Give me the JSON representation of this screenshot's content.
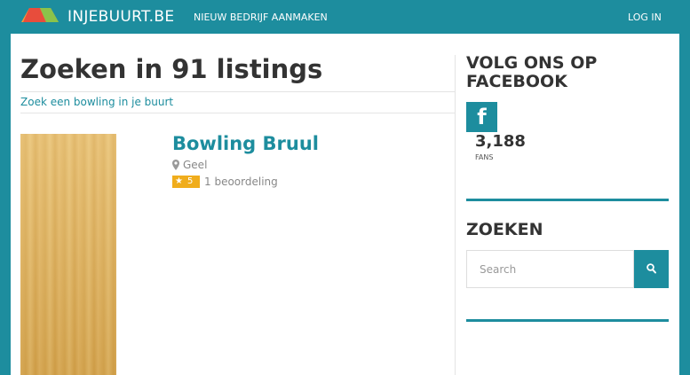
{
  "header": {
    "logo_text": "INJEBUURT.BE",
    "nav_new_business": "NIEUW BEDRIJF AANMAKEN",
    "nav_login": "LOG IN"
  },
  "main": {
    "title": "Zoeken in 91 listings",
    "subheading": "Zoek een bowling in je buurt",
    "listings": [
      {
        "title": "Bowling Bruul",
        "location": "Geel",
        "rating": "5",
        "review_count": "1 beoordeling"
      }
    ]
  },
  "sidebar": {
    "facebook_title": "VOLG ONS OP FACEBOOK",
    "facebook_icon": "f",
    "fan_count": "3,188",
    "fans_label": "FANS",
    "search_title": "ZOEKEN",
    "search_placeholder": "Search"
  },
  "colors": {
    "brand": "#1d8d9e",
    "rating_badge": "#f0ad1c"
  },
  "icons": [
    "logo-icon",
    "map-pin-icon",
    "star-icon",
    "facebook-icon",
    "search-icon"
  ]
}
